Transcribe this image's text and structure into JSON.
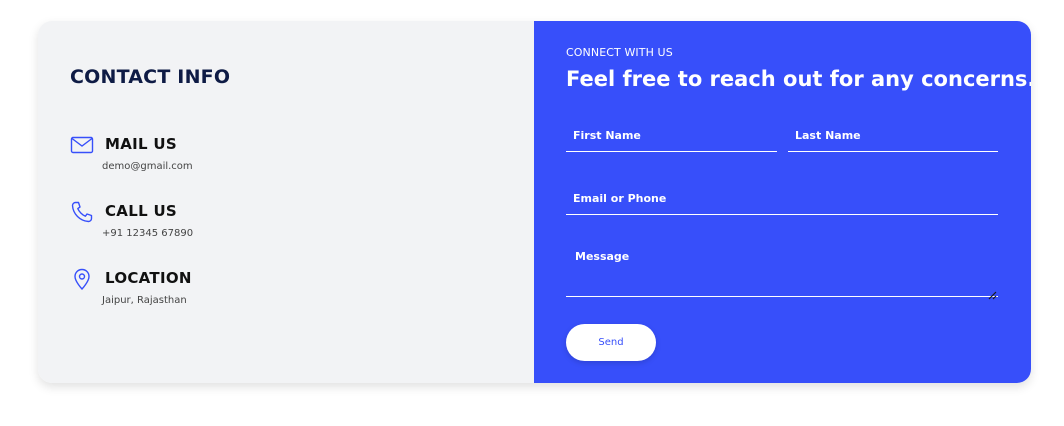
{
  "contact_info": {
    "title": "CONTACT INFO",
    "items": [
      {
        "icon": "mail-icon",
        "heading": "MAIL US",
        "value": "demo@gmail.com"
      },
      {
        "icon": "phone-icon",
        "heading": "CALL US",
        "value": "+91 12345 67890"
      },
      {
        "icon": "location-pin-icon",
        "heading": "LOCATION",
        "value": "Jaipur, Rajasthan"
      }
    ]
  },
  "form": {
    "eyebrow": "CONNECT WITH US",
    "headline": "Feel free to reach out for any concerns.",
    "first_name": {
      "placeholder": "First Name",
      "value": ""
    },
    "last_name": {
      "placeholder": "Last Name",
      "value": ""
    },
    "email_phone": {
      "placeholder": "Email or Phone",
      "value": ""
    },
    "message": {
      "placeholder": "Message",
      "value": ""
    },
    "send_label": "Send"
  },
  "colors": {
    "accent": "#374ffa",
    "left_panel": "#f2f3f5",
    "title_navy": "#0e1b45"
  }
}
